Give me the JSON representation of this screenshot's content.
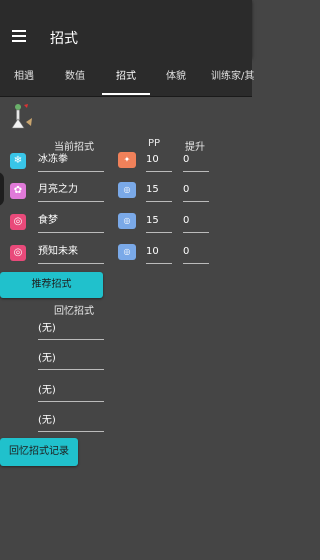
{
  "app_bar": {
    "title": "招式"
  },
  "tabs": [
    {
      "label": "相遇",
      "active": false
    },
    {
      "label": "数值",
      "active": false
    },
    {
      "label": "招式",
      "active": true
    },
    {
      "label": "体貌",
      "active": false
    },
    {
      "label": "训练家/其",
      "active": false
    }
  ],
  "headers": {
    "current_moves": "当前招式",
    "pp": "PP",
    "boost": "提升"
  },
  "moves": [
    {
      "type_icon": "ice-type-icon",
      "type_color": "#39c5e8",
      "type_glyph": "❄",
      "name": "冰冻拳",
      "category_icon": "physical-category-icon",
      "category_color": "#f0815a",
      "pp": "10",
      "boost": "0"
    },
    {
      "type_icon": "fairy-type-icon",
      "type_color": "#e07ad9",
      "type_glyph": "✿",
      "name": "月亮之力",
      "category_icon": "special-category-icon",
      "category_color": "#7aa9e8",
      "pp": "15",
      "boost": "0"
    },
    {
      "type_icon": "psychic-type-icon",
      "type_color": "#e94a7a",
      "type_glyph": "◎",
      "name": "食梦",
      "category_icon": "special-category-icon",
      "category_color": "#7aa9e8",
      "pp": "15",
      "boost": "0"
    },
    {
      "type_icon": "psychic-type-icon",
      "type_color": "#e94a7a",
      "type_glyph": "◎",
      "name": "预知未来",
      "category_icon": "special-category-icon",
      "category_color": "#7aa9e8",
      "pp": "10",
      "boost": "0"
    }
  ],
  "recommend_button": "推荐招式",
  "recall_header": "回忆招式",
  "recall_moves": [
    "(无)",
    "(无)",
    "(无)",
    "(无)"
  ],
  "recall_button": "回忆招式记录"
}
